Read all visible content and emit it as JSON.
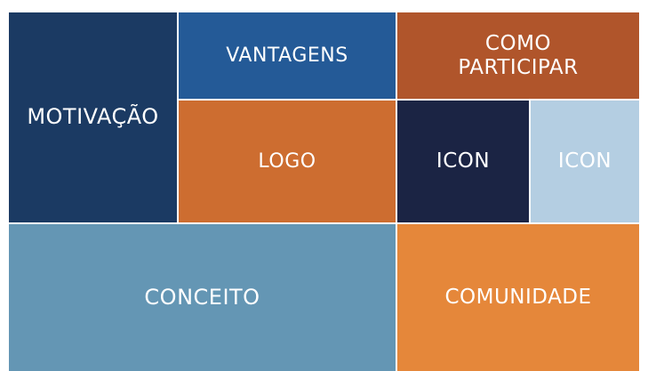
{
  "tiles": {
    "motivacao": {
      "label": "MOTIVAÇÃO",
      "color": "#1b3a63"
    },
    "vantagens": {
      "label": "VANTAGENS",
      "color": "#245a97"
    },
    "como_participar": {
      "line1": "COMO",
      "line2": "PARTICIPAR",
      "color": "#b0552b"
    },
    "logo": {
      "label": "LOGO",
      "color": "#cd6d30"
    },
    "icon_dark": {
      "label": "ICON",
      "color": "#1b2444"
    },
    "icon_light": {
      "label": "ICON",
      "color": "#b4cee2"
    },
    "conceito": {
      "label": "CONCEITO",
      "color": "#6496b4"
    },
    "comunidade": {
      "label": "COMUNIDADE",
      "color": "#e5873a"
    }
  }
}
